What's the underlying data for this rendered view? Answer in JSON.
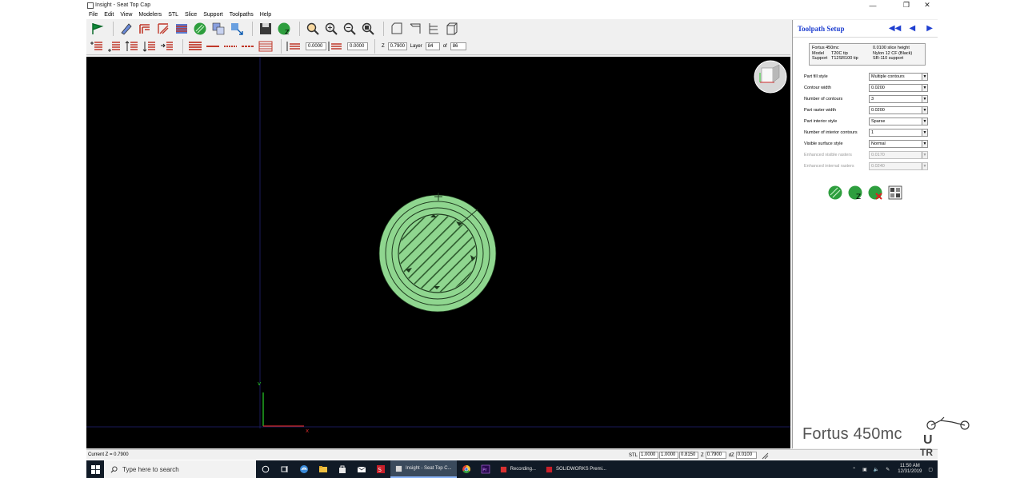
{
  "window": {
    "title": "Insight - Seat Top Cap"
  },
  "menu": [
    "File",
    "Edit",
    "View",
    "Modelers",
    "STL",
    "Slice",
    "Support",
    "Toolpaths",
    "Help"
  ],
  "toolbar2": {
    "width1": "0.0000",
    "width2": "0.0000",
    "z_label": "Z",
    "z_value": "0.7900",
    "layer_label": "Layer",
    "layer_value": "84",
    "of_label": "of",
    "of_value": "86"
  },
  "status": {
    "current": "Current Z = 0.7900",
    "stl_label": "STL",
    "stl_values": [
      "1.0000",
      "1.0000",
      "0.8150"
    ],
    "z_label": "Z",
    "z_value": "0.7900",
    "dz_label": "dZ",
    "dz_value": "0.0100"
  },
  "panel": {
    "title": "Toolpath Setup",
    "info": [
      {
        "k": "",
        "v": "Fortus 450mc",
        "v2": "0.0100 slice height"
      },
      {
        "k": "Model",
        "v": "T20C tip",
        "v2": "Nylon 12 CF (Black)"
      },
      {
        "k": "Support",
        "v": "T12SR100 tip",
        "v2": "SR-110 support"
      }
    ],
    "params": [
      {
        "label": "Part fill style",
        "value": "Multiple contours",
        "disabled": false
      },
      {
        "label": "Contour width",
        "value": "0.0200",
        "disabled": false
      },
      {
        "label": "Number of contours",
        "value": "3",
        "disabled": false
      },
      {
        "label": "Part raster width",
        "value": "0.0200",
        "disabled": false
      },
      {
        "label": "Part interior style",
        "value": "Sparse",
        "disabled": false
      },
      {
        "label": "Number of interior contours",
        "value": "1",
        "disabled": false
      },
      {
        "label": "Visible surface style",
        "value": "Normal",
        "disabled": false
      },
      {
        "label": "Enhanced visible rasters",
        "value": "0.0170",
        "disabled": true
      },
      {
        "label": "Enhanced internal rasters",
        "value": "0.0240",
        "disabled": true
      }
    ],
    "brand": "Fortus 450mc"
  },
  "taskbar": {
    "search_placeholder": "Type here to search",
    "apps": [
      "Insight - Seat Top C...",
      "Recording...",
      "SOLIDWORKS Premi..."
    ],
    "time": "11:50 AM",
    "date": "12/31/2019"
  },
  "watermark": {
    "line1": "U",
    "line2": "TR"
  },
  "colors": {
    "part": "#8fd68f",
    "accent": "#1f3fd0",
    "viewport": "#000000"
  }
}
